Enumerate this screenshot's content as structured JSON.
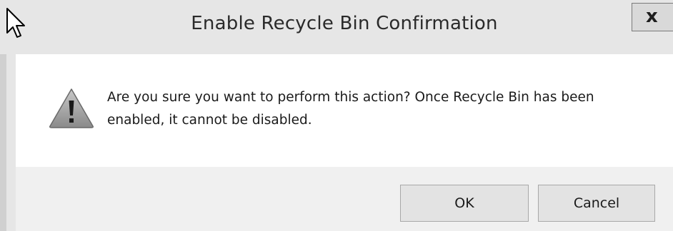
{
  "window": {
    "title": "Enable Recycle Bin Confirmation",
    "close_label": "x"
  },
  "dialog": {
    "icon": "warning-icon",
    "message": "Are you sure you want to perform this action? Once Recycle Bin has been enabled, it cannot be disabled."
  },
  "buttons": {
    "ok_label": "OK",
    "cancel_label": "Cancel"
  },
  "colors": {
    "content_bg": "#ffffff",
    "footer_bg": "#f0f0f0",
    "title_bg": "#e6e6e6"
  }
}
